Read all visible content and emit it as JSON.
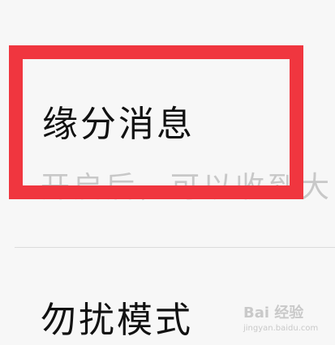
{
  "settings": {
    "item1": {
      "title": "缘分消息",
      "description": "开启后，可以收到大"
    },
    "item2": {
      "title": "勿扰模式"
    }
  },
  "watermark": {
    "main": "Bai 经验",
    "sub": "jingyan.baidu.com"
  },
  "colors": {
    "highlight": "#f0363f",
    "background": "#f7f7f7",
    "description_text": "#c8c8c8"
  },
  "icons": [
    "back-arrow-icon"
  ]
}
